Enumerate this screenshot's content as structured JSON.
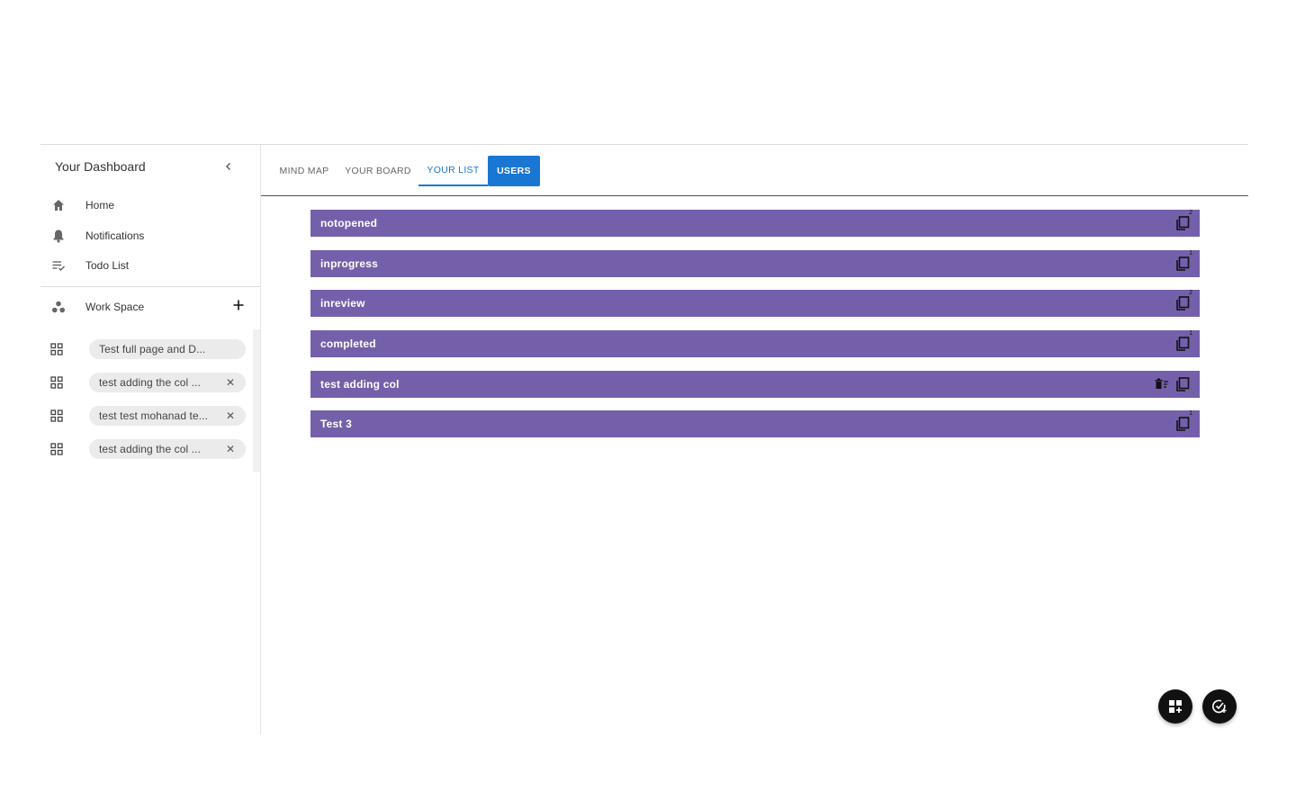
{
  "sidebar": {
    "title": "Your Dashboard",
    "nav": [
      {
        "label": "Home",
        "icon": "home-icon"
      },
      {
        "label": "Notifications",
        "icon": "bell-icon"
      },
      {
        "label": "Todo List",
        "icon": "checklist-icon"
      }
    ],
    "workspace": {
      "label": "Work Space",
      "icon": "workspace-icon"
    },
    "workspaces": [
      {
        "label": "Test full page and D...",
        "closable": false
      },
      {
        "label": "test adding the col ...",
        "closable": true
      },
      {
        "label": "test test mohanad te...",
        "closable": true
      },
      {
        "label": "test adding the col ...",
        "closable": true
      }
    ],
    "close_glyph": "✕"
  },
  "tabs": [
    {
      "label": "MIND MAP",
      "state": "normal"
    },
    {
      "label": "YOUR BOARD",
      "state": "normal"
    },
    {
      "label": "YOUR LIST",
      "state": "active"
    },
    {
      "label": "USERS",
      "state": "highlight"
    }
  ],
  "list": {
    "color": "#7460aa",
    "rows": [
      {
        "label": "notopened",
        "badge": "2",
        "delete": false
      },
      {
        "label": "inprogress",
        "badge": "1",
        "delete": false
      },
      {
        "label": "inreview",
        "badge": "2",
        "delete": false
      },
      {
        "label": "completed",
        "badge": "1",
        "delete": false
      },
      {
        "label": "test adding col",
        "badge": "",
        "delete": true
      },
      {
        "label": "Test 3",
        "badge": "1",
        "delete": false
      }
    ]
  },
  "fabs": [
    {
      "name": "add-board-fab",
      "icon": "dashboard-add-icon"
    },
    {
      "name": "add-task-fab",
      "icon": "task-add-icon"
    }
  ],
  "colors": {
    "accent": "#1976d2",
    "row": "#7460aa",
    "fab": "#111111"
  }
}
